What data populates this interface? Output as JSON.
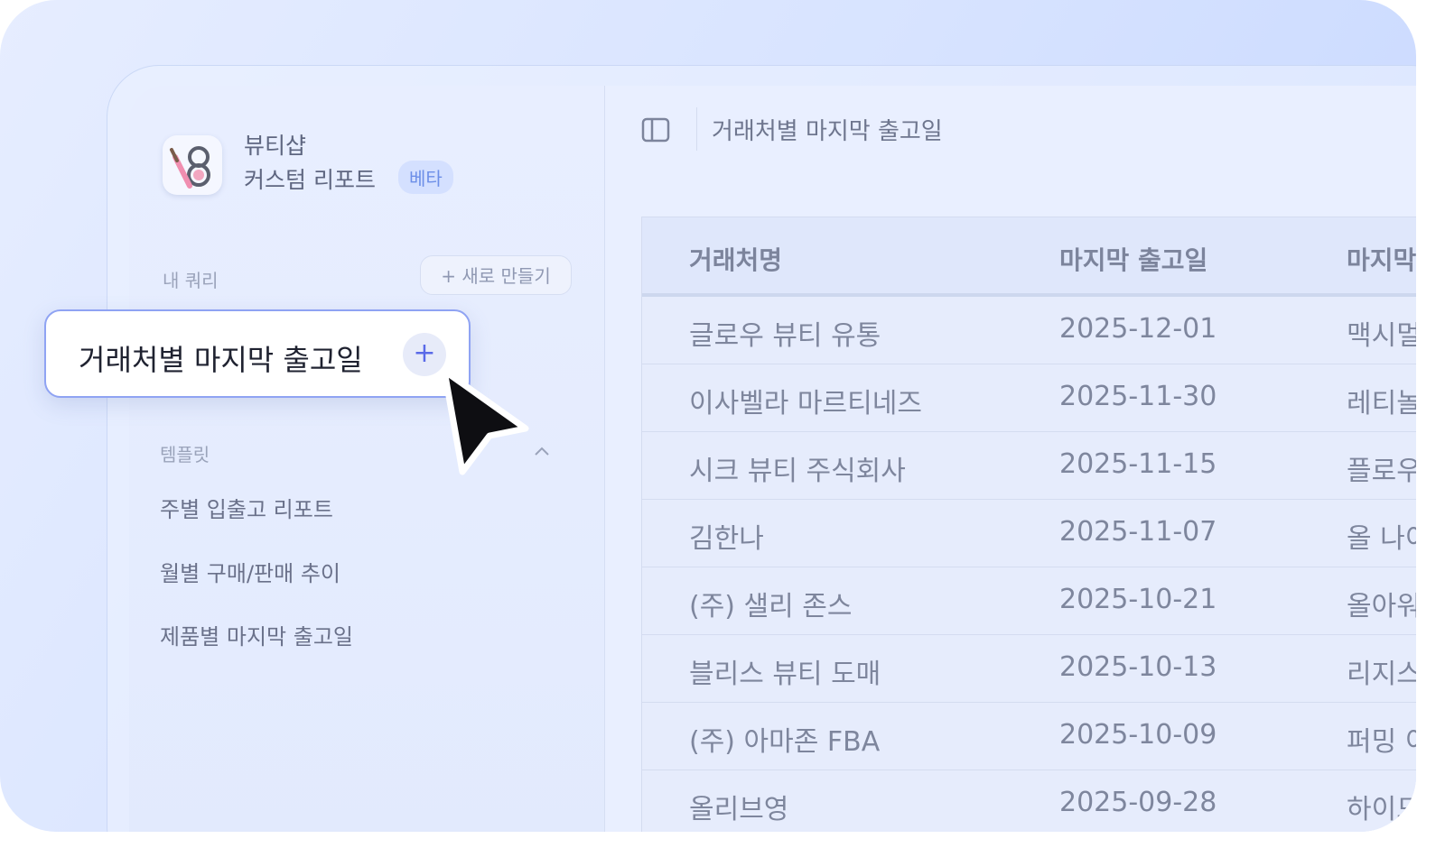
{
  "brand": {
    "name": "뷰티샵",
    "subtitle": "커스텀 리포트",
    "badge": "베타",
    "logo_icon": "makeup-brush-compact-icon"
  },
  "sidebar": {
    "my_queries_label": "내 쿼리",
    "new_button": "+ 새로 만들기",
    "templates_label": "템플릿",
    "templates": [
      "주별 입출고 리포트",
      "월별 구매/판매 추이",
      "제품별 마지막 출고일"
    ]
  },
  "popup": {
    "label": "거래처별 마지막 출고일",
    "add": "+"
  },
  "main": {
    "title": "거래처별 마지막 출고일",
    "table": {
      "headers": [
        "거래처명",
        "마지막 출고일",
        "마지막"
      ],
      "rows": [
        [
          "글로우 뷰티 유통",
          "2025-12-01",
          "맥시멀"
        ],
        [
          "이사벨라 마르티네즈",
          "2025-11-30",
          "레티놀"
        ],
        [
          "시크 뷰티 주식회사",
          "2025-11-15",
          "플로우"
        ],
        [
          "김한나",
          "2025-11-07",
          "올 나이"
        ],
        [
          "(주) 샐리 존스",
          "2025-10-21",
          "올아워"
        ],
        [
          "블리스 뷰티 도매",
          "2025-10-13",
          "리지스"
        ],
        [
          "(주) 아마존 FBA",
          "2025-10-09",
          "퍼밍 이"
        ],
        [
          "올리브영",
          "2025-09-28",
          "하이드"
        ]
      ]
    }
  },
  "colors": {
    "accent": "#5a6ae8",
    "badge_bg": "#d4e0ff",
    "popup_border": "#8fa3f3"
  }
}
